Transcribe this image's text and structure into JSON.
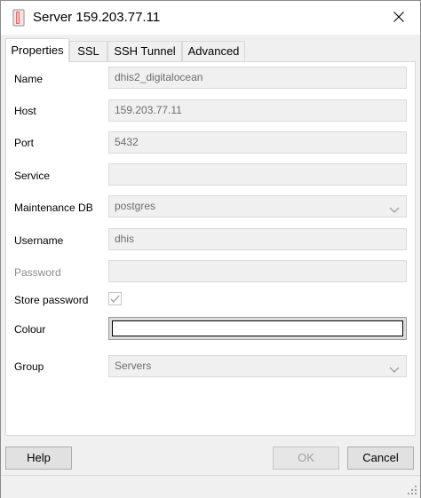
{
  "window": {
    "title": "Server 159.203.77.11"
  },
  "tabs": [
    {
      "label": "Properties",
      "active": true
    },
    {
      "label": "SSL",
      "active": false
    },
    {
      "label": "SSH Tunnel",
      "active": false
    },
    {
      "label": "Advanced",
      "active": false
    }
  ],
  "form": {
    "name": {
      "label": "Name",
      "value": "dhis2_digitalocean"
    },
    "host": {
      "label": "Host",
      "value": "159.203.77.11"
    },
    "port": {
      "label": "Port",
      "value": "5432"
    },
    "service": {
      "label": "Service",
      "value": ""
    },
    "maintenance_db": {
      "label": "Maintenance DB",
      "value": "postgres"
    },
    "username": {
      "label": "Username",
      "value": "dhis"
    },
    "password": {
      "label": "Password",
      "value": ""
    },
    "store_password": {
      "label": "Store password",
      "checked": true
    },
    "colour": {
      "label": "Colour",
      "value": "#ffffff"
    },
    "group": {
      "label": "Group",
      "value": "Servers"
    }
  },
  "buttons": {
    "help": "Help",
    "ok": "OK",
    "cancel": "Cancel"
  },
  "icons": {
    "app": "server-icon",
    "close": "close-icon",
    "chevron": "chevron-down-icon",
    "check": "checkmark-icon",
    "grip": "resize-grip-icon"
  }
}
